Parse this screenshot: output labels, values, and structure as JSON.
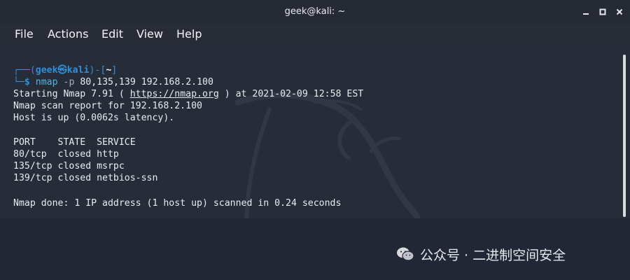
{
  "window": {
    "title": "geek@kali: ~"
  },
  "menubar": {
    "items": [
      "File",
      "Actions",
      "Edit",
      "View",
      "Help"
    ]
  },
  "terminal": {
    "prompt": {
      "top_left": "┌──(",
      "user": "geek",
      "at": "㉿",
      "host": "kali",
      "mid": ")-[",
      "dir": "~",
      "close": "]",
      "bottom_left": "└─",
      "dollar": "$",
      "command": "nmap",
      "option": "-p",
      "args": "80,135,139 192.168.2.100"
    },
    "lines": {
      "starting_prefix": "Starting Nmap 7.91 ( ",
      "starting_url": "https://nmap.org",
      "starting_suffix": " ) at 2021-02-09 12:58 EST",
      "scan_report": "Nmap scan report for 192.168.2.100",
      "host_up": "Host is up (0.0062s latency).",
      "table_header": "PORT    STATE  SERVICE",
      "row1": "80/tcp  closed http",
      "row2": "135/tcp closed msrpc",
      "row3": "139/tcp closed netbios-ssn",
      "done": "Nmap done: 1 IP address (1 host up) scanned in 0.24 seconds"
    }
  },
  "watermark": {
    "text": "公众号 · 二进制空间安全",
    "icon": "wechat-icon"
  }
}
